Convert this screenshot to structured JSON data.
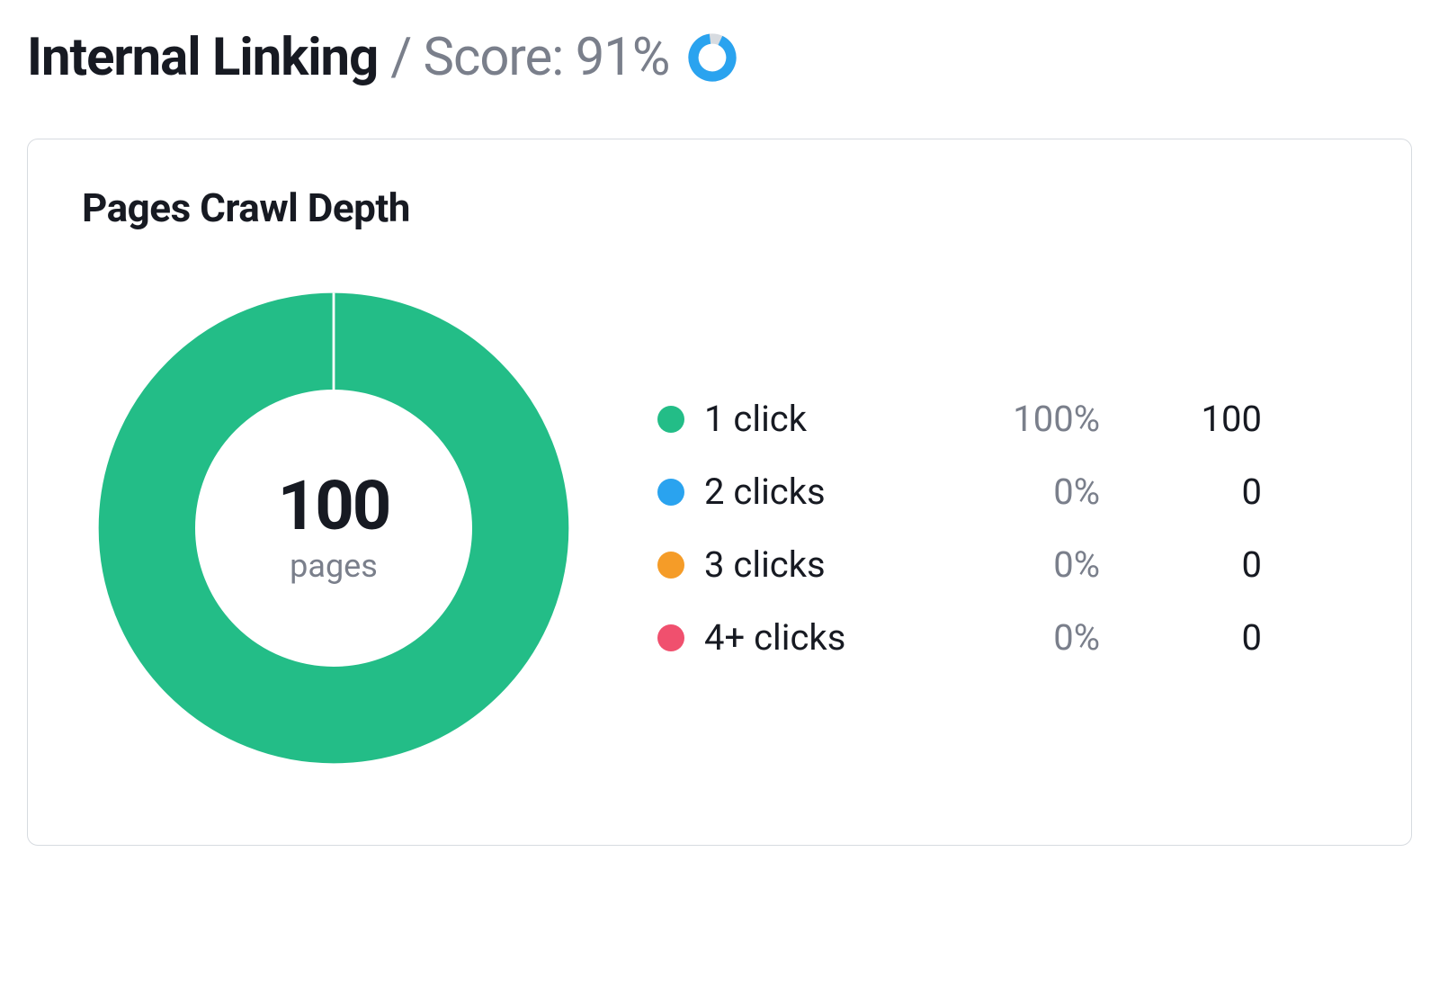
{
  "header": {
    "title": "Internal Linking",
    "score_label": "/ Score: 91%",
    "score_value": 91
  },
  "card": {
    "title": "Pages Crawl Depth",
    "center_number": "100",
    "center_label": "pages"
  },
  "colors": {
    "teal": "#23bd87",
    "blue": "#2aa3ef",
    "orange": "#f59c28",
    "red": "#f0506e",
    "ring_accent": "#2aa3ef",
    "ring_muted": "#d7dbe0"
  },
  "legend": {
    "items": [
      {
        "name": "1 click",
        "color_key": "teal",
        "pct": "100%",
        "count": "100"
      },
      {
        "name": "2 clicks",
        "color_key": "blue",
        "pct": "0%",
        "count": "0"
      },
      {
        "name": "3 clicks",
        "color_key": "orange",
        "pct": "0%",
        "count": "0"
      },
      {
        "name": "4+ clicks",
        "color_key": "red",
        "pct": "0%",
        "count": "0"
      }
    ]
  },
  "chart_data": {
    "type": "pie",
    "title": "Pages Crawl Depth",
    "slices": [
      {
        "label": "1 click",
        "value": 100,
        "pct": 100,
        "color": "#23bd87"
      },
      {
        "label": "2 clicks",
        "value": 0,
        "pct": 0,
        "color": "#2aa3ef"
      },
      {
        "label": "3 clicks",
        "value": 0,
        "pct": 0,
        "color": "#f59c28"
      },
      {
        "label": "4+ clicks",
        "value": 0,
        "pct": 0,
        "color": "#f0506e"
      }
    ],
    "total": 100,
    "total_label": "pages",
    "score_ring": {
      "value": 91,
      "max": 100
    }
  }
}
